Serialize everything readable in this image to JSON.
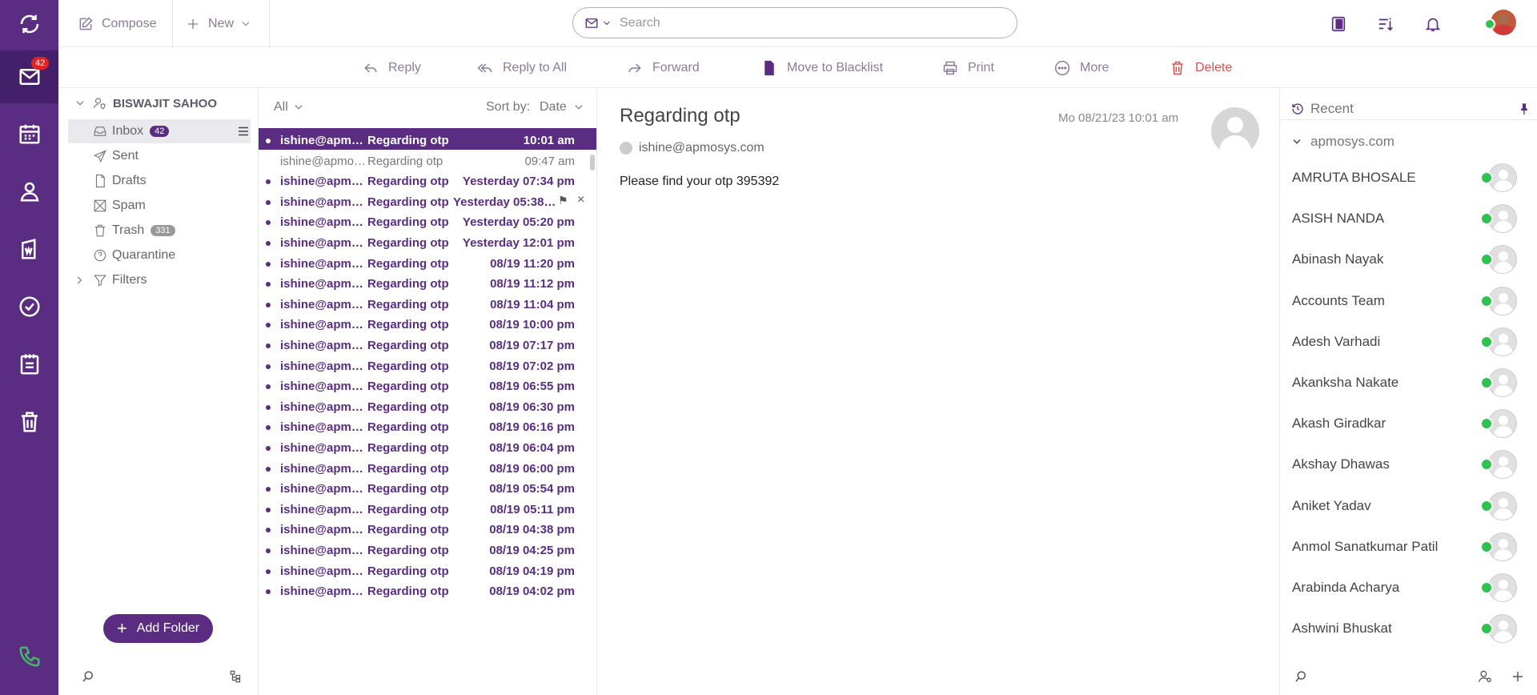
{
  "rail": {
    "mail_badge": "42"
  },
  "topbar": {
    "compose_label": "Compose",
    "new_label": "New",
    "search_placeholder": "Search"
  },
  "actions": {
    "reply": "Reply",
    "reply_all": "Reply to All",
    "forward": "Forward",
    "blacklist": "Move to Blacklist",
    "print": "Print",
    "more": "More",
    "delete": "Delete"
  },
  "folders": {
    "account": "BISWAJIT SAHOO",
    "items": [
      {
        "label": "Inbox",
        "count": "42"
      },
      {
        "label": "Sent"
      },
      {
        "label": "Drafts"
      },
      {
        "label": "Spam"
      },
      {
        "label": "Trash",
        "count": "331"
      },
      {
        "label": "Quarantine"
      },
      {
        "label": "Filters"
      }
    ],
    "add_folder": "Add Folder"
  },
  "list": {
    "filter": "All",
    "sort_by_label": "Sort by:",
    "sort_value": "Date",
    "rows": [
      {
        "from": "ishine@apmosys.com",
        "subject": "Regarding otp",
        "date": "10:01 am",
        "state": "selected"
      },
      {
        "from": "ishine@apmosys.com",
        "subject": "Regarding otp",
        "date": "09:47 am",
        "state": "read"
      },
      {
        "from": "ishine@apmosys.com",
        "subject": "Regarding otp",
        "date": "Yesterday 07:34 pm",
        "state": "unread"
      },
      {
        "from": "ishine@apmosys.com",
        "subject": "Regarding otp",
        "date": "Yesterday 05:38 pm",
        "state": "unread"
      },
      {
        "from": "ishine@apmosys.com",
        "subject": "Regarding otp",
        "date": "Yesterday 05:20 pm",
        "state": "unread"
      },
      {
        "from": "ishine@apmosys.com",
        "subject": "Regarding otp",
        "date": "Yesterday 12:01 pm",
        "state": "unread"
      },
      {
        "from": "ishine@apmosys.com",
        "subject": "Regarding otp",
        "date": "08/19 11:20 pm",
        "state": "unread"
      },
      {
        "from": "ishine@apmosys.com",
        "subject": "Regarding otp",
        "date": "08/19 11:12 pm",
        "state": "unread"
      },
      {
        "from": "ishine@apmosys.com",
        "subject": "Regarding otp",
        "date": "08/19 11:04 pm",
        "state": "unread"
      },
      {
        "from": "ishine@apmosys.com",
        "subject": "Regarding otp",
        "date": "08/19 10:00 pm",
        "state": "unread"
      },
      {
        "from": "ishine@apmosys.com",
        "subject": "Regarding otp",
        "date": "08/19 07:17 pm",
        "state": "unread"
      },
      {
        "from": "ishine@apmosys.com",
        "subject": "Regarding otp",
        "date": "08/19 07:02 pm",
        "state": "unread"
      },
      {
        "from": "ishine@apmosys.com",
        "subject": "Regarding otp",
        "date": "08/19 06:55 pm",
        "state": "unread"
      },
      {
        "from": "ishine@apmosys.com",
        "subject": "Regarding otp",
        "date": "08/19 06:30 pm",
        "state": "unread"
      },
      {
        "from": "ishine@apmosys.com",
        "subject": "Regarding otp",
        "date": "08/19 06:16 pm",
        "state": "unread"
      },
      {
        "from": "ishine@apmosys.com",
        "subject": "Regarding otp",
        "date": "08/19 06:04 pm",
        "state": "unread"
      },
      {
        "from": "ishine@apmosys.com",
        "subject": "Regarding otp",
        "date": "08/19 06:00 pm",
        "state": "unread"
      },
      {
        "from": "ishine@apmosys.com",
        "subject": "Regarding otp",
        "date": "08/19 05:54 pm",
        "state": "unread"
      },
      {
        "from": "ishine@apmosys.com",
        "subject": "Regarding otp",
        "date": "08/19 05:11 pm",
        "state": "unread"
      },
      {
        "from": "ishine@apmosys.com",
        "subject": "Regarding otp",
        "date": "08/19 04:38 pm",
        "state": "unread"
      },
      {
        "from": "ishine@apmosys.com",
        "subject": "Regarding otp",
        "date": "08/19 04:25 pm",
        "state": "unread"
      },
      {
        "from": "ishine@apmosys.com",
        "subject": "Regarding otp",
        "date": "08/19 04:19 pm",
        "state": "unread"
      },
      {
        "from": "ishine@apmosys.com",
        "subject": "Regarding otp",
        "date": "08/19 04:02 pm",
        "state": "unread"
      }
    ]
  },
  "message": {
    "subject": "Regarding otp",
    "date": "Mo 08/21/23 10:01 am",
    "from": "ishine@apmosys.com",
    "body": "Please find your otp 395392"
  },
  "contacts": {
    "header": "Recent",
    "group": "apmosys.com",
    "people": [
      "AMRUTA BHOSALE",
      "ASISH NANDA",
      "Abinash Nayak",
      "Accounts Team",
      "Adesh Varhadi",
      "Akanksha Nakate",
      "Akash Giradkar",
      "Akshay Dhawas",
      "Aniket Yadav",
      "Anmol Sanatkumar Patil",
      "Arabinda Acharya",
      "Ashwini Bhuskat"
    ]
  },
  "colors": {
    "brand": "#5a2d82",
    "online": "#2ec24e",
    "delete": "#e05050",
    "badge": "#e02424"
  }
}
